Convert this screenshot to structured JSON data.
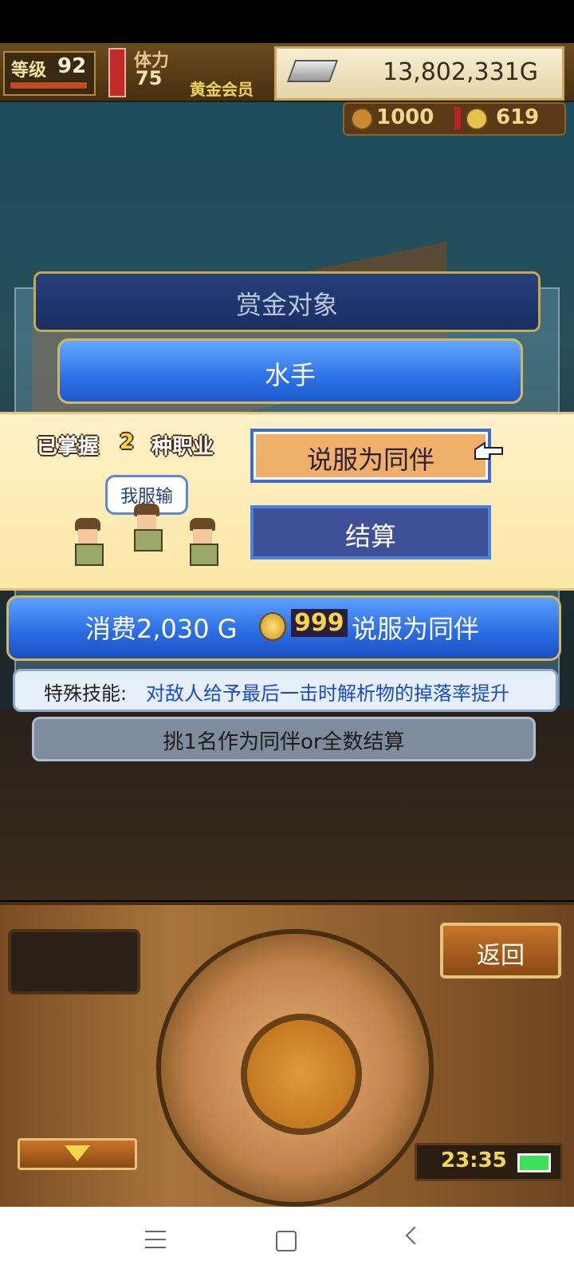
{
  "hud": {
    "level_label": "等级",
    "level": "92",
    "stamina_label": "体力",
    "stamina": "75",
    "membership": "黄金会员",
    "money": "13,802,331G",
    "resource1": "1000",
    "resource2": "619"
  },
  "dialog": {
    "title": "赏金对象",
    "job": "水手",
    "mastered_prefix": "已掌握",
    "mastered_count": "2",
    "mastered_suffix": "种职业",
    "speech": "我服输",
    "persuade_label": "说服为同伴",
    "settle_label": "结算",
    "cost_text": "消费2,030 G",
    "cost_gems": "999",
    "cost_action": "说服为同伴",
    "skill_label": "特殊技能:",
    "skill_desc": "对敌人给予最后一击时解析物的掉落率提升",
    "pick_text": "挑1名作为同伴or全数结算"
  },
  "controls": {
    "back_label": "返回",
    "time": "23:35"
  },
  "colors": {
    "accent_blue": "#2d72e6",
    "persuade_bg": "#f0b06a",
    "panel_yellow": "#fbe7a6"
  }
}
